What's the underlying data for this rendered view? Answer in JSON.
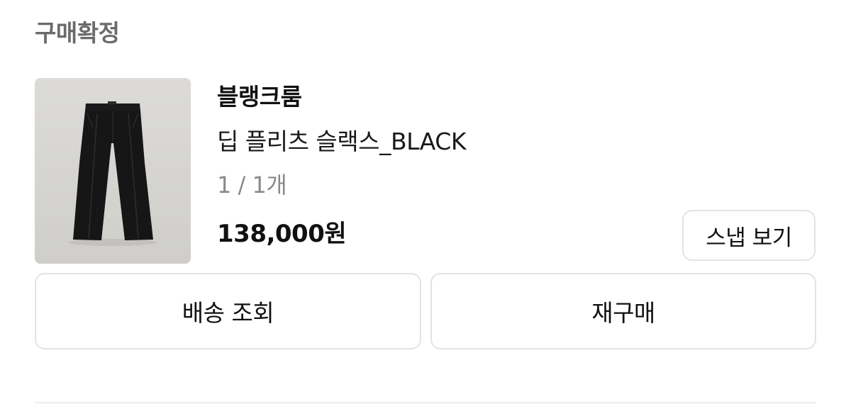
{
  "order": {
    "status": "구매확정",
    "item": {
      "brand": "블랭크룸",
      "name": "딥 플리츠 슬랙스_BLACK",
      "quantity": "1 / 1개",
      "price": "138,000원",
      "image_icon": "black-pants-product-photo"
    },
    "buttons": {
      "snap": "스냅 보기",
      "shipping": "배송 조회",
      "rebuy": "재구매"
    }
  },
  "colors": {
    "status_text": "#6b6b6b",
    "primary_text": "#111111",
    "secondary_text": "#8a8a8a",
    "button_border": "#e3e3e3",
    "image_background": "#d5d4d0"
  }
}
